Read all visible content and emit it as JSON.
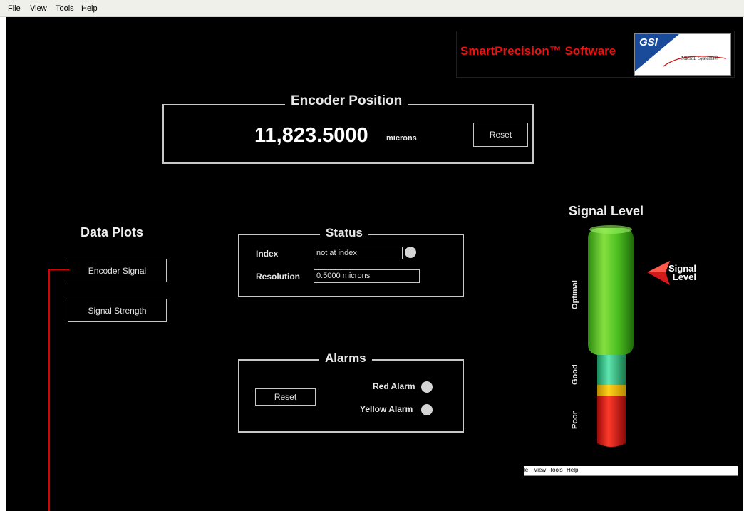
{
  "menu": {
    "file": "File",
    "view": "View",
    "tools": "Tools",
    "help": "Help"
  },
  "logo": {
    "title": "SmartPrecision™ Software",
    "brand": "GSI",
    "subtitle": "MicroE Systems®"
  },
  "encoder": {
    "title": "Encoder Position",
    "value": "11,823.5000",
    "unit": "microns",
    "reset_label": "Reset"
  },
  "data_plots": {
    "title": "Data Plots",
    "encoder_signal_label": "Encoder Signal",
    "signal_strength_label": "Signal Strength"
  },
  "status": {
    "title": "Status",
    "index_label": "Index",
    "index_value": "not at index",
    "resolution_label": "Resolution",
    "resolution_value": "0.5000 microns"
  },
  "alarms": {
    "title": "Alarms",
    "reset_label": "Reset",
    "red_alarm_label": "Red Alarm",
    "yellow_alarm_label": "Yellow Alarm"
  },
  "signal_level": {
    "title": "Signal Level",
    "optimal_label": "Optimal",
    "good_label": "Good",
    "poor_label": "Poor",
    "pointer_line1": "Signal",
    "pointer_line2": "Level"
  },
  "mini_menu": {
    "file": "le",
    "view": "View",
    "tools": "Tools",
    "help": "Help"
  },
  "colors": {
    "background": "#000000",
    "logo_red": "#ee1111",
    "led_gray": "#d4d4d4",
    "connector_red": "#dd0000"
  }
}
